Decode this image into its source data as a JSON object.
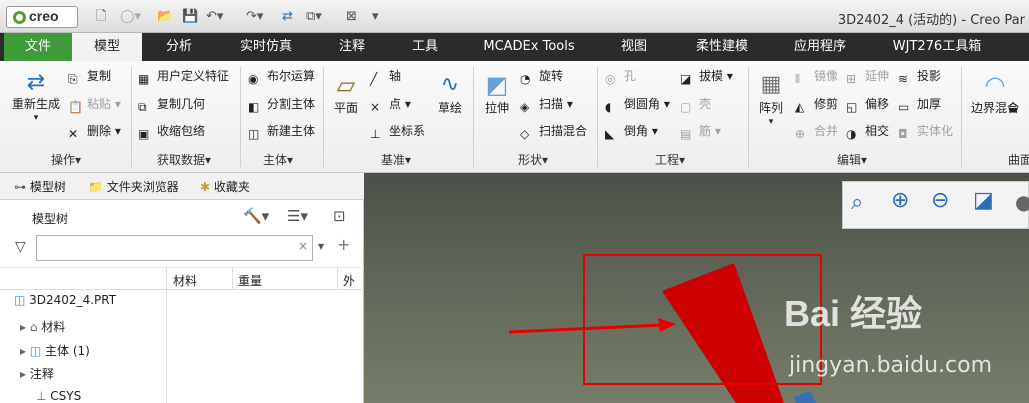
{
  "app": {
    "logo": "creo",
    "window_title": "3D2402_4 (活动的) - Creo Par"
  },
  "tabs": [
    "文件",
    "模型",
    "分析",
    "实时仿真",
    "注释",
    "工具",
    "MCADEx Tools",
    "视图",
    "柔性建模",
    "应用程序",
    "WJT276工具箱"
  ],
  "ribbon": {
    "operations": {
      "regen": "重新生成",
      "copy": "复制",
      "paste": "粘贴",
      "delete": "删除",
      "group": "操作"
    },
    "get_data": {
      "udf": "用户定义特征",
      "copy_geom": "复制几何",
      "shrinkwrap": "收缩包络",
      "group": "获取数据"
    },
    "body": {
      "boolean": "布尔运算",
      "split": "分割主体",
      "new_body": "新建主体",
      "group": "主体"
    },
    "datum": {
      "plane": "平面",
      "axis": "轴",
      "point": "点",
      "csys": "坐标系",
      "sketch": "草绘",
      "group": "基准"
    },
    "shapes": {
      "extrude": "拉伸",
      "revolve": "旋转",
      "sweep": "扫描",
      "swept_blend": "扫描混合",
      "group": "形状"
    },
    "engineering": {
      "hole": "孔",
      "round": "倒圆角",
      "chamfer": "倒角",
      "draft": "拔模",
      "shell": "壳",
      "rib": "筋",
      "group": "工程"
    },
    "editing": {
      "pattern": "阵列",
      "mirror": "镜像",
      "trim": "修剪",
      "merge": "合并",
      "extend": "延伸",
      "offset": "偏移",
      "intersect": "相交",
      "project": "投影",
      "thicken": "加厚",
      "solidify": "实体化",
      "group": "编辑"
    },
    "surfaces": {
      "boundary_blend": "边界混合",
      "group": "曲面"
    }
  },
  "panel": {
    "tabs": [
      "模型树",
      "文件夹浏览器",
      "收藏夹"
    ],
    "tree_title": "模型树",
    "search_value": "",
    "columns": [
      "材料",
      "重量",
      "外"
    ],
    "items": [
      {
        "label": "3D2402_4.PRT",
        "icon": "part-icon"
      },
      {
        "label": "材料",
        "icon": "material-icon"
      },
      {
        "label": "主体 (1)",
        "icon": "body-icon"
      },
      {
        "label": "注释",
        "icon": "annotation-icon"
      },
      {
        "label": "CSYS",
        "icon": "csys-icon"
      }
    ]
  },
  "viewport": {
    "watermark_brand": "Bai  经验",
    "watermark_url": "jingyan.baidu.com"
  }
}
